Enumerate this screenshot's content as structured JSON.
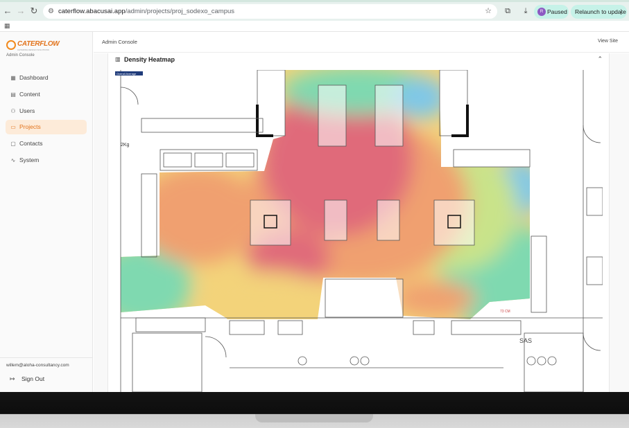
{
  "browser": {
    "url_domain": "caterflow.abacusai.app",
    "url_path": "/admin/projects/proj_sodexo_campus",
    "profile_initial": "R",
    "paused_label": "Paused",
    "relaunch_label": "Relaunch to update"
  },
  "sidebar": {
    "logo_text": "CATERFLOW",
    "logo_tagline": "CATERING DESIGN SOLUTIONS",
    "subtitle": "Admin Console",
    "items": [
      {
        "label": "Dashboard",
        "icon": "grid-icon"
      },
      {
        "label": "Content",
        "icon": "document-icon"
      },
      {
        "label": "Users",
        "icon": "users-icon"
      },
      {
        "label": "Projects",
        "icon": "folder-icon",
        "active": true
      },
      {
        "label": "Contacts",
        "icon": "chat-icon"
      },
      {
        "label": "System",
        "icon": "pulse-icon"
      }
    ],
    "user_email": "willem@aloha-consultancy.com",
    "signout_label": "Sign Out"
  },
  "topbar": {
    "title": "Admin Console",
    "view_site": "View Site"
  },
  "heatmap": {
    "title": "Density Heatmap",
    "legend_tag": "Overall Average",
    "room_label_sas": "SAS",
    "plan_label_kg": "2Kg",
    "dimension_label": "73 CM",
    "colors": {
      "high": "#e06b7a",
      "mid_high": "#f0a070",
      "mid": "#f3d37a",
      "low_mid": "#c9e38a",
      "low": "#7fd9b0",
      "lowest": "#7fc7e8"
    }
  },
  "colors": {
    "accent": "#e2731b",
    "active_bg": "#fdebd9",
    "pill_bg": "#c6f2e8"
  }
}
